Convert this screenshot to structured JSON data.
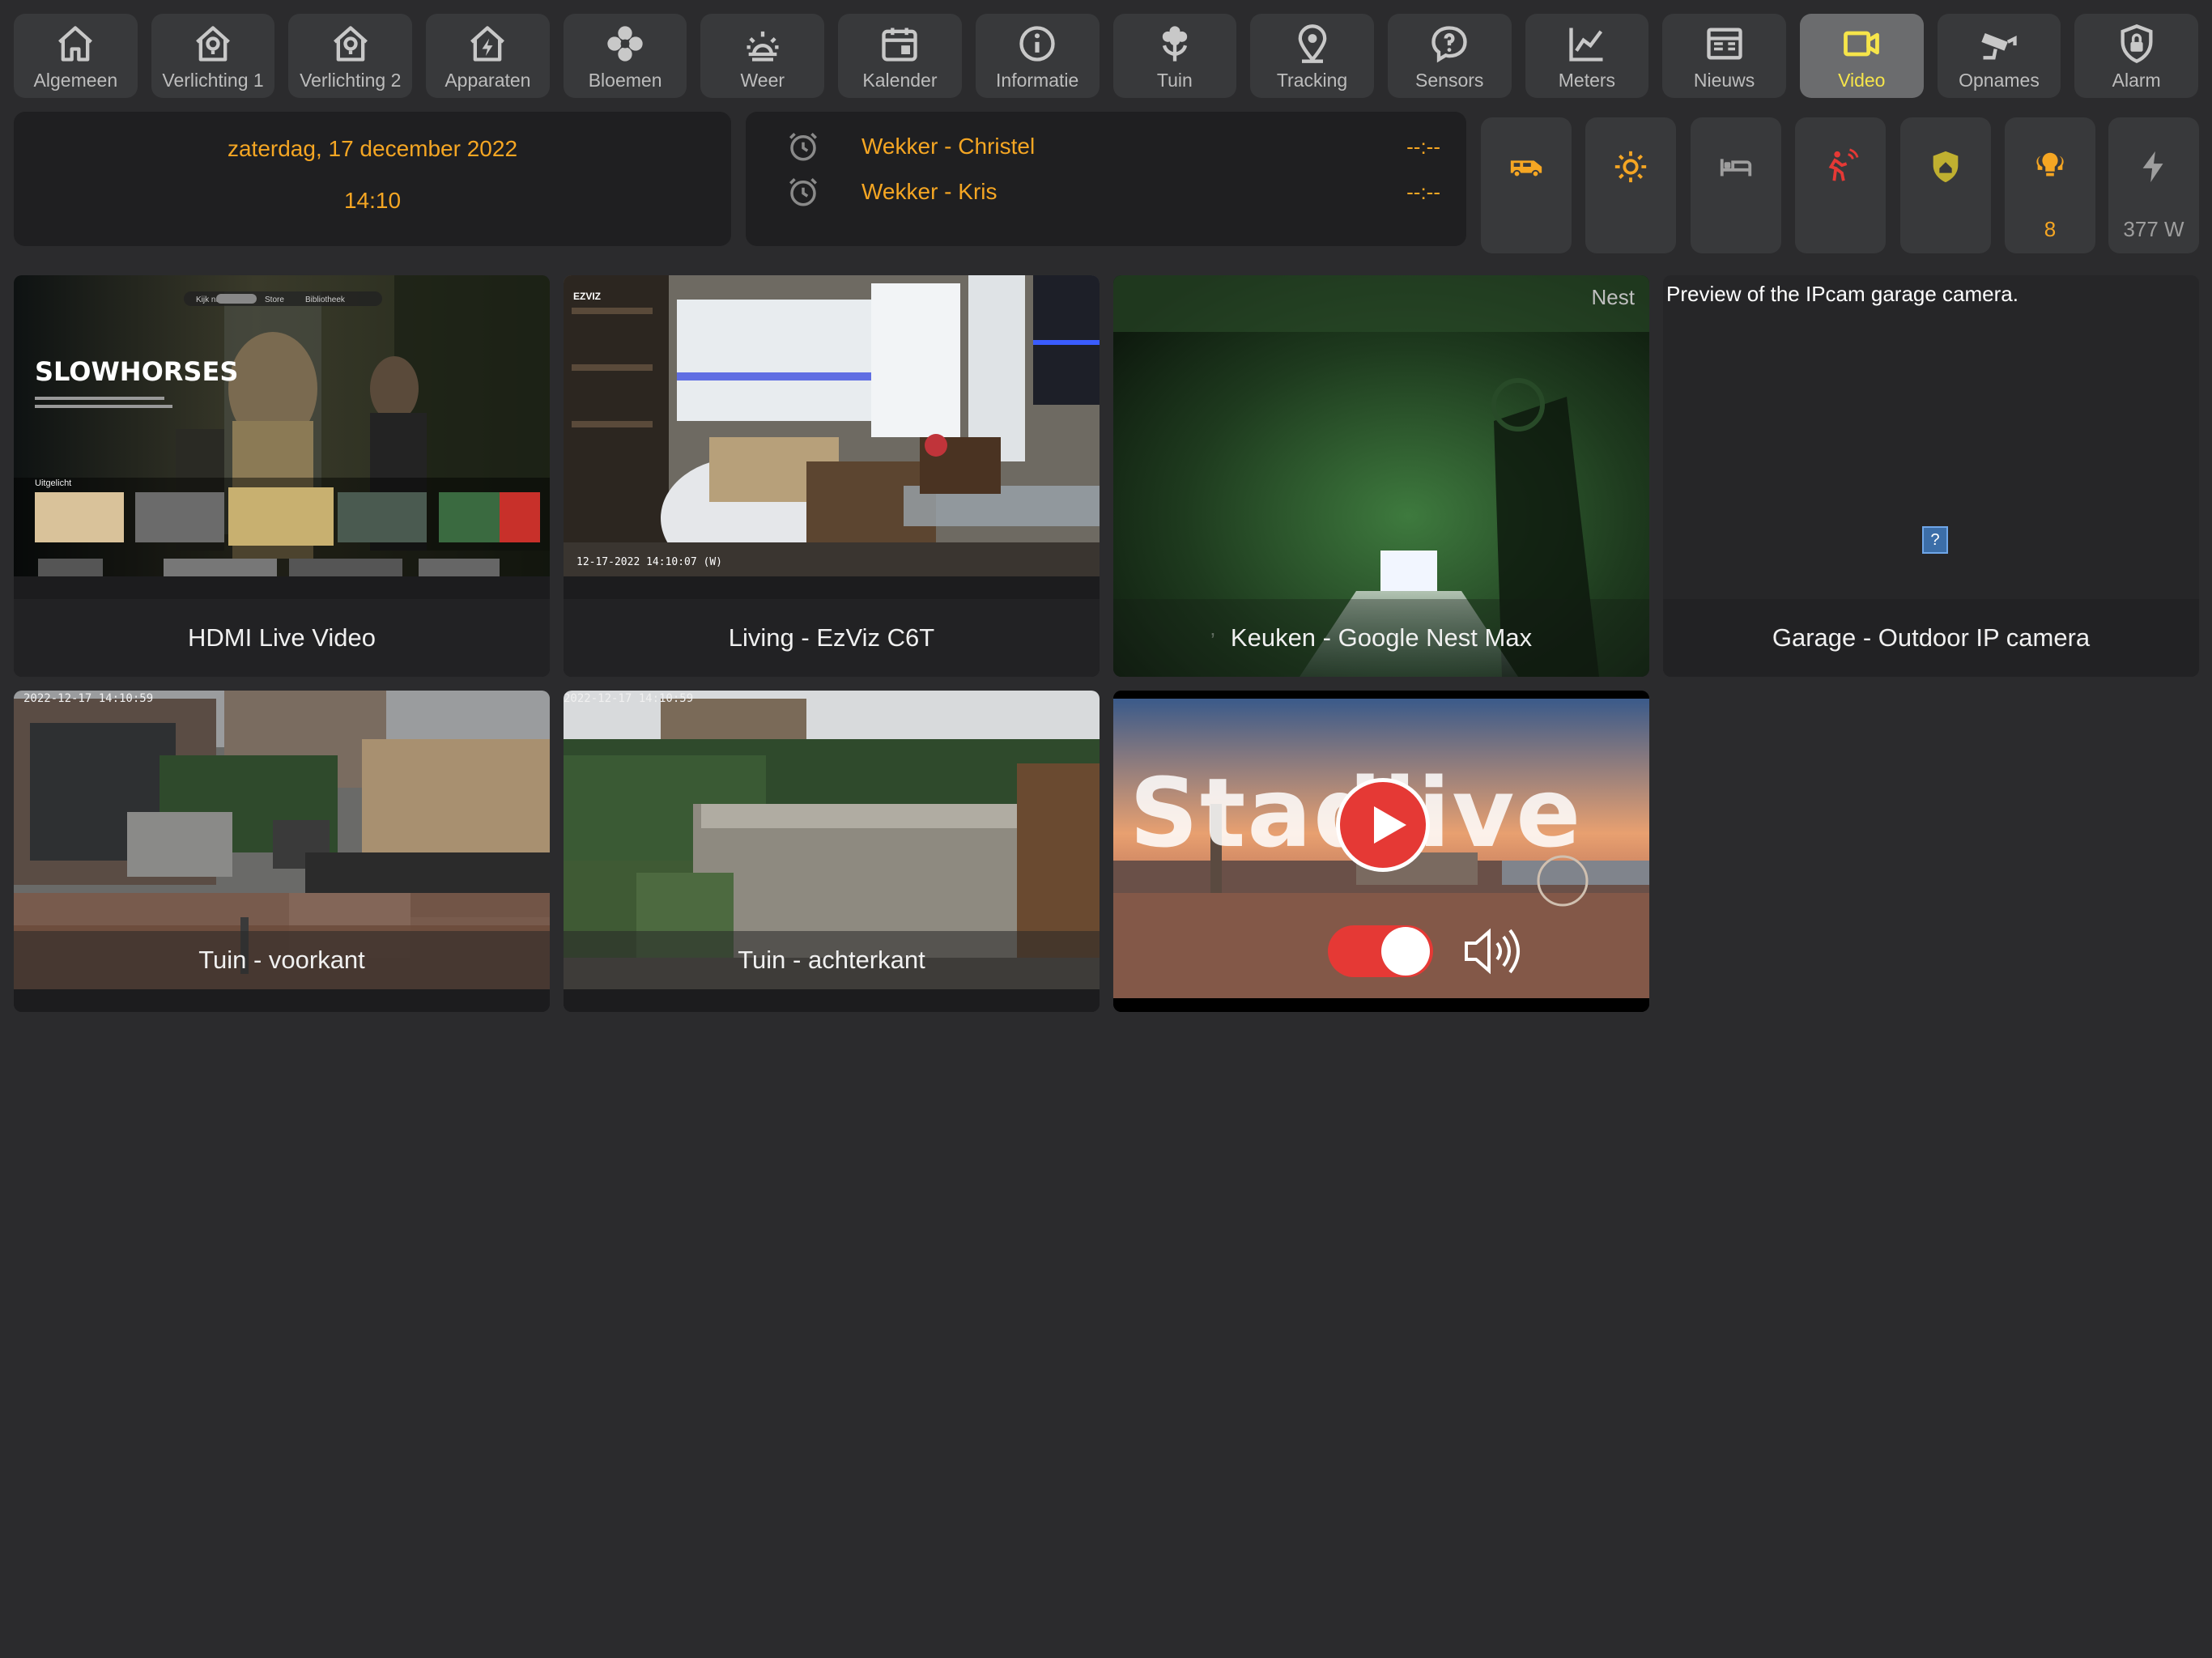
{
  "nav": {
    "tabs": [
      {
        "label": "Algemeen",
        "icon": "home-icon"
      },
      {
        "label": "Verlichting 1",
        "icon": "home-lightbulb-icon"
      },
      {
        "label": "Verlichting 2",
        "icon": "home-lightbulb-icon"
      },
      {
        "label": "Apparaten",
        "icon": "home-lightning-icon"
      },
      {
        "label": "Bloemen",
        "icon": "flower-icon"
      },
      {
        "label": "Weer",
        "icon": "weather-sunset-icon"
      },
      {
        "label": "Kalender",
        "icon": "calendar-icon"
      },
      {
        "label": "Informatie",
        "icon": "information-icon"
      },
      {
        "label": "Tuin",
        "icon": "flower-tulip-icon"
      },
      {
        "label": "Tracking",
        "icon": "map-marker-icon"
      },
      {
        "label": "Sensors",
        "icon": "comment-question-icon"
      },
      {
        "label": "Meters",
        "icon": "chart-line-icon"
      },
      {
        "label": "Nieuws",
        "icon": "newspaper-icon"
      },
      {
        "label": "Video",
        "icon": "video-camera-icon",
        "active": true
      },
      {
        "label": "Opnames",
        "icon": "cctv-icon"
      },
      {
        "label": "Alarm",
        "icon": "shield-lock-icon"
      }
    ]
  },
  "header": {
    "date": "zaterdag, 17 december 2022",
    "time": "14:10"
  },
  "alarms": [
    {
      "name": "Wekker - Christel",
      "time": "--:--"
    },
    {
      "name": "Wekker - Kris",
      "time": "--:--"
    }
  ],
  "status_tiles": [
    {
      "icon": "van-icon",
      "color": "#f5a623",
      "value": ""
    },
    {
      "icon": "sun-icon",
      "color": "#f5a623",
      "value": ""
    },
    {
      "icon": "bed-icon",
      "color": "#9e9e9e",
      "value": ""
    },
    {
      "icon": "motion-sensor-icon",
      "color": "#e53935",
      "value": ""
    },
    {
      "icon": "shield-home-icon",
      "color": "#c0b030",
      "value": ""
    },
    {
      "icon": "lightbulb-group-icon",
      "color": "#f5a623",
      "value": "8"
    },
    {
      "icon": "flash-icon",
      "color": "#9e9e9e",
      "value": "377 W"
    }
  ],
  "videos": {
    "hdmi": {
      "caption": "HDMI Live Video"
    },
    "living": {
      "caption": "Living - EzViz C6T",
      "brand": "EZVIZ",
      "timestamp": "12-17-2022 14:10:07 (W)"
    },
    "keuken": {
      "caption": "Keuken - Google Nest Max",
      "badge": "Nest"
    },
    "garage": {
      "caption": "Garage - Outdoor IP camera",
      "preview_text": "Preview of the IPcam garage camera."
    },
    "tuin_voor": {
      "caption": "Tuin - voorkant",
      "timestamp": "2022-12-17 14:10:59"
    },
    "tuin_achter": {
      "caption": "Tuin - achterkant",
      "timestamp": "2022-12-17 14:10:59"
    },
    "stadlive": {
      "title": "Stadlive"
    }
  },
  "hdmi_screen": {
    "show_title": "SLOWHORSES",
    "menu": [
      "Kijk nu",
      "Store",
      "Bibliotheek"
    ],
    "row_label": "Uitgelicht"
  },
  "colors": {
    "accent": "#f5a623",
    "active_tab": "#f6e54a",
    "background": "#2b2b2d",
    "tile": "#38393b"
  }
}
